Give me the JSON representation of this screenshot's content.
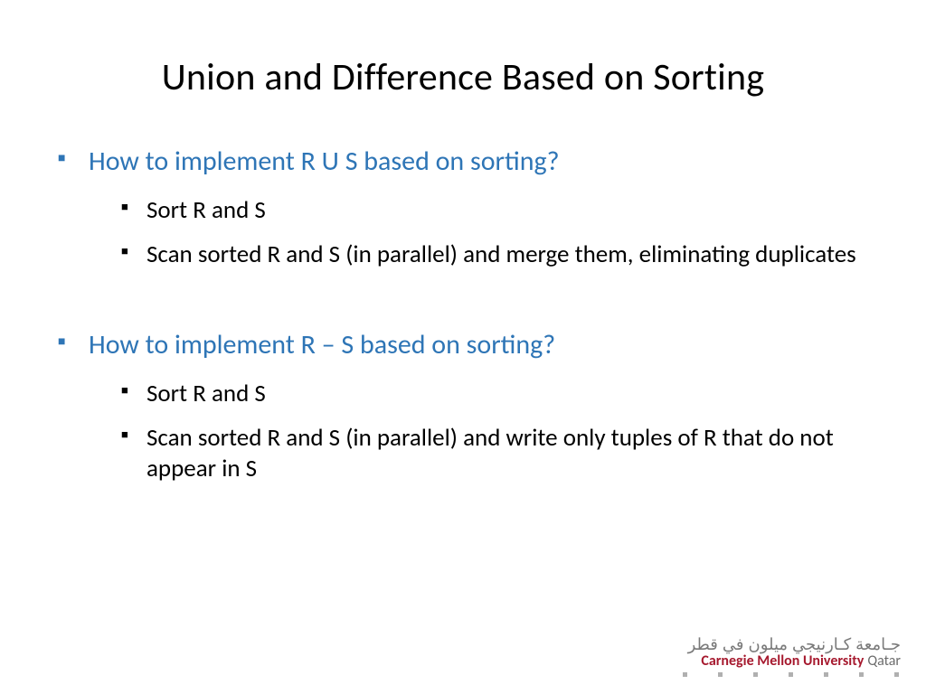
{
  "title": "Union and Difference Based on Sorting",
  "sections": [
    {
      "heading": "How to implement R U S based on sorting?",
      "items": [
        "Sort R and S",
        "Scan sorted R and S (in parallel) and merge them, eliminating duplicates"
      ]
    },
    {
      "heading": "How to implement R – S based on sorting?",
      "items": [
        "Sort R and S",
        "Scan sorted R and S (in parallel) and write only tuples of R that do not appear in S"
      ]
    }
  ],
  "footer": {
    "arabic": "جـامعة كـارنيجي ميلون في قطر",
    "org_bold": "Carnegie Mellon University",
    "org_gray": "Qatar"
  }
}
